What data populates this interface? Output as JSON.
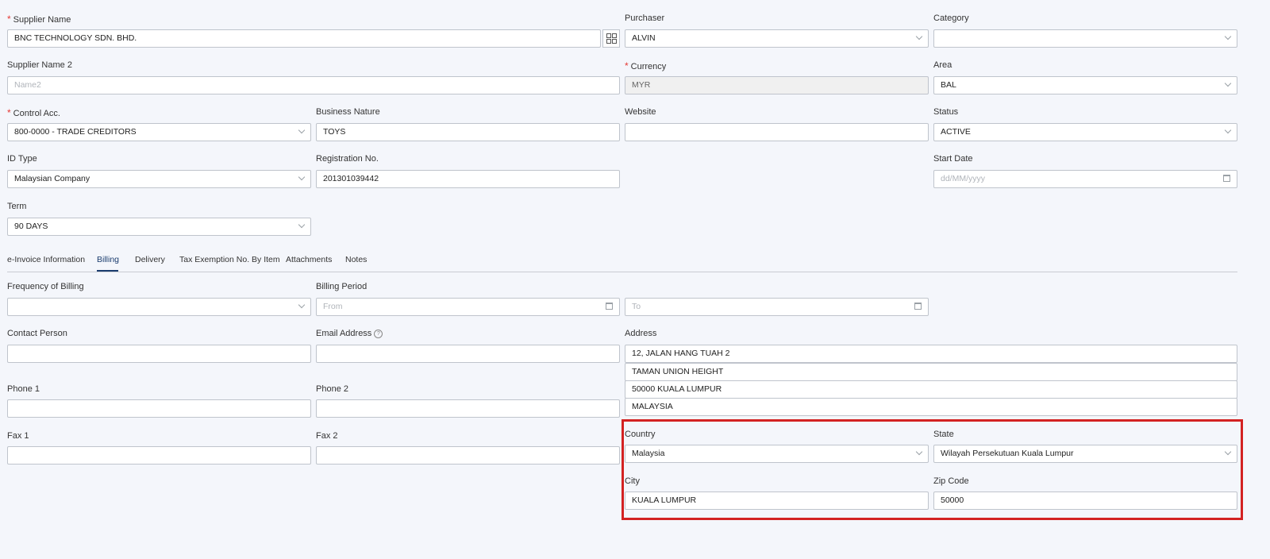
{
  "labels": {
    "supplier_name": "Supplier Name",
    "purchaser": "Purchaser",
    "category": "Category",
    "supplier_name2": "Supplier Name 2",
    "currency": "Currency",
    "area": "Area",
    "control_acc": "Control Acc.",
    "business_nature": "Business Nature",
    "website": "Website",
    "status": "Status",
    "id_type": "ID Type",
    "registration_no": "Registration No.",
    "start_date": "Start Date",
    "term": "Term",
    "frequency_of_billing": "Frequency of Billing",
    "billing_period": "Billing Period",
    "contact_person": "Contact Person",
    "email_address": "Email Address",
    "address": "Address",
    "phone1": "Phone 1",
    "phone2": "Phone 2",
    "fax1": "Fax 1",
    "fax2": "Fax 2",
    "country": "Country",
    "state": "State",
    "city": "City",
    "zip_code": "Zip Code"
  },
  "required_marker": "*",
  "help_icon_glyph": "?",
  "values": {
    "supplier_name": "BNC TECHNOLOGY SDN. BHD.",
    "purchaser": "ALVIN",
    "category": "",
    "currency": "MYR",
    "area": "BAL",
    "control_acc": "800-0000 - TRADE CREDITORS",
    "business_nature": "TOYS",
    "website": "",
    "status": "ACTIVE",
    "id_type": "Malaysian Company",
    "registration_no": "201301039442",
    "term": "90 DAYS",
    "frequency_of_billing": "",
    "contact_person": "",
    "email_address": "",
    "address_line1": "12, JALAN HANG TUAH 2",
    "address_line2": "TAMAN UNION HEIGHT",
    "address_line3": "50000 KUALA LUMPUR",
    "address_line4": "MALAYSIA",
    "phone1": "",
    "phone2": "",
    "fax1": "",
    "fax2": "",
    "country": "Malaysia",
    "state": "Wilayah Persekutuan Kuala Lumpur",
    "city": "KUALA LUMPUR",
    "zip_code": "50000"
  },
  "placeholders": {
    "supplier_name2": "Name2",
    "start_date": "dd/MM/yyyy",
    "billing_from": "From",
    "billing_to": "To"
  },
  "tabs": [
    {
      "label": "e-Invoice Information",
      "active": false
    },
    {
      "label": "Billing",
      "active": true
    },
    {
      "label": "Delivery",
      "active": false
    },
    {
      "label": "Tax Exemption No. By Item",
      "active": false
    },
    {
      "label": "Attachments",
      "active": false
    },
    {
      "label": "Notes",
      "active": false
    }
  ],
  "colors": {
    "required": "#e53935",
    "active_tab": "#1a3c6e",
    "highlight_box": "#d32222"
  }
}
